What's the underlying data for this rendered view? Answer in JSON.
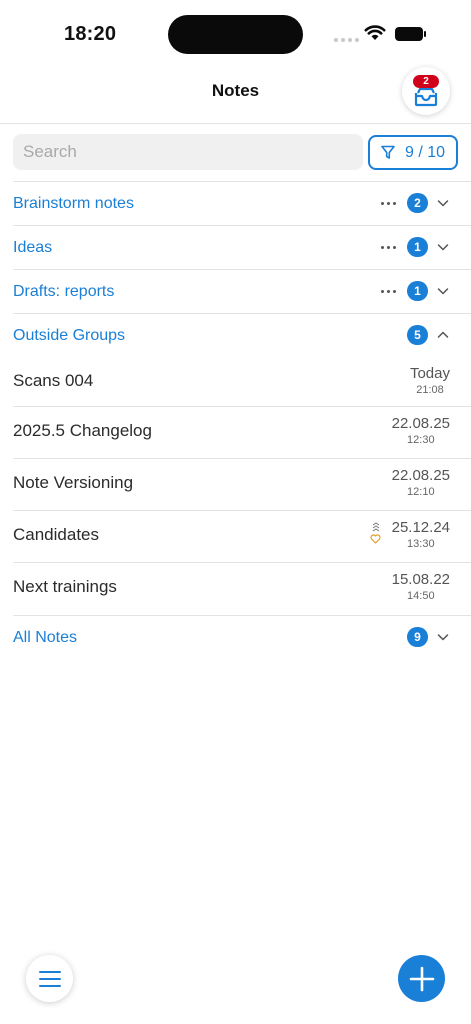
{
  "status_bar": {
    "time": "18:20"
  },
  "header": {
    "title": "Notes",
    "inbox_badge": "2"
  },
  "search": {
    "placeholder": "Search",
    "value": ""
  },
  "filter": {
    "label": "9 / 10"
  },
  "groups": [
    {
      "label": "Brainstorm notes",
      "count": "2"
    },
    {
      "label": "Ideas",
      "count": "1"
    },
    {
      "label": "Drafts: reports",
      "count": "1"
    }
  ],
  "outside_groups": {
    "label": "Outside Groups",
    "count": "5",
    "notes": [
      {
        "title": "Scans 004",
        "date": "Today",
        "time": "21:08"
      },
      {
        "title": "2025.5 Changelog",
        "date": "22.08.25",
        "time": "12:30"
      },
      {
        "title": "Note Versioning",
        "date": "22.08.25",
        "time": "12:10"
      },
      {
        "title": "Candidates",
        "date": "25.12.24",
        "time": "13:30"
      },
      {
        "title": "Next trainings",
        "date": "15.08.22",
        "time": "14:50"
      }
    ]
  },
  "all_notes": {
    "label": "All Notes",
    "count": "9"
  },
  "colors": {
    "accent": "#1a7fd6",
    "badge_red": "#d0021b",
    "heart": "#e0a030"
  },
  "icons": [
    "wifi-icon",
    "battery-icon",
    "inbox-icon",
    "filter-icon",
    "more-dots-icon",
    "chevron-down-icon",
    "chevron-up-icon",
    "versions-icon",
    "heart-icon",
    "menu-icon",
    "plus-icon"
  ]
}
